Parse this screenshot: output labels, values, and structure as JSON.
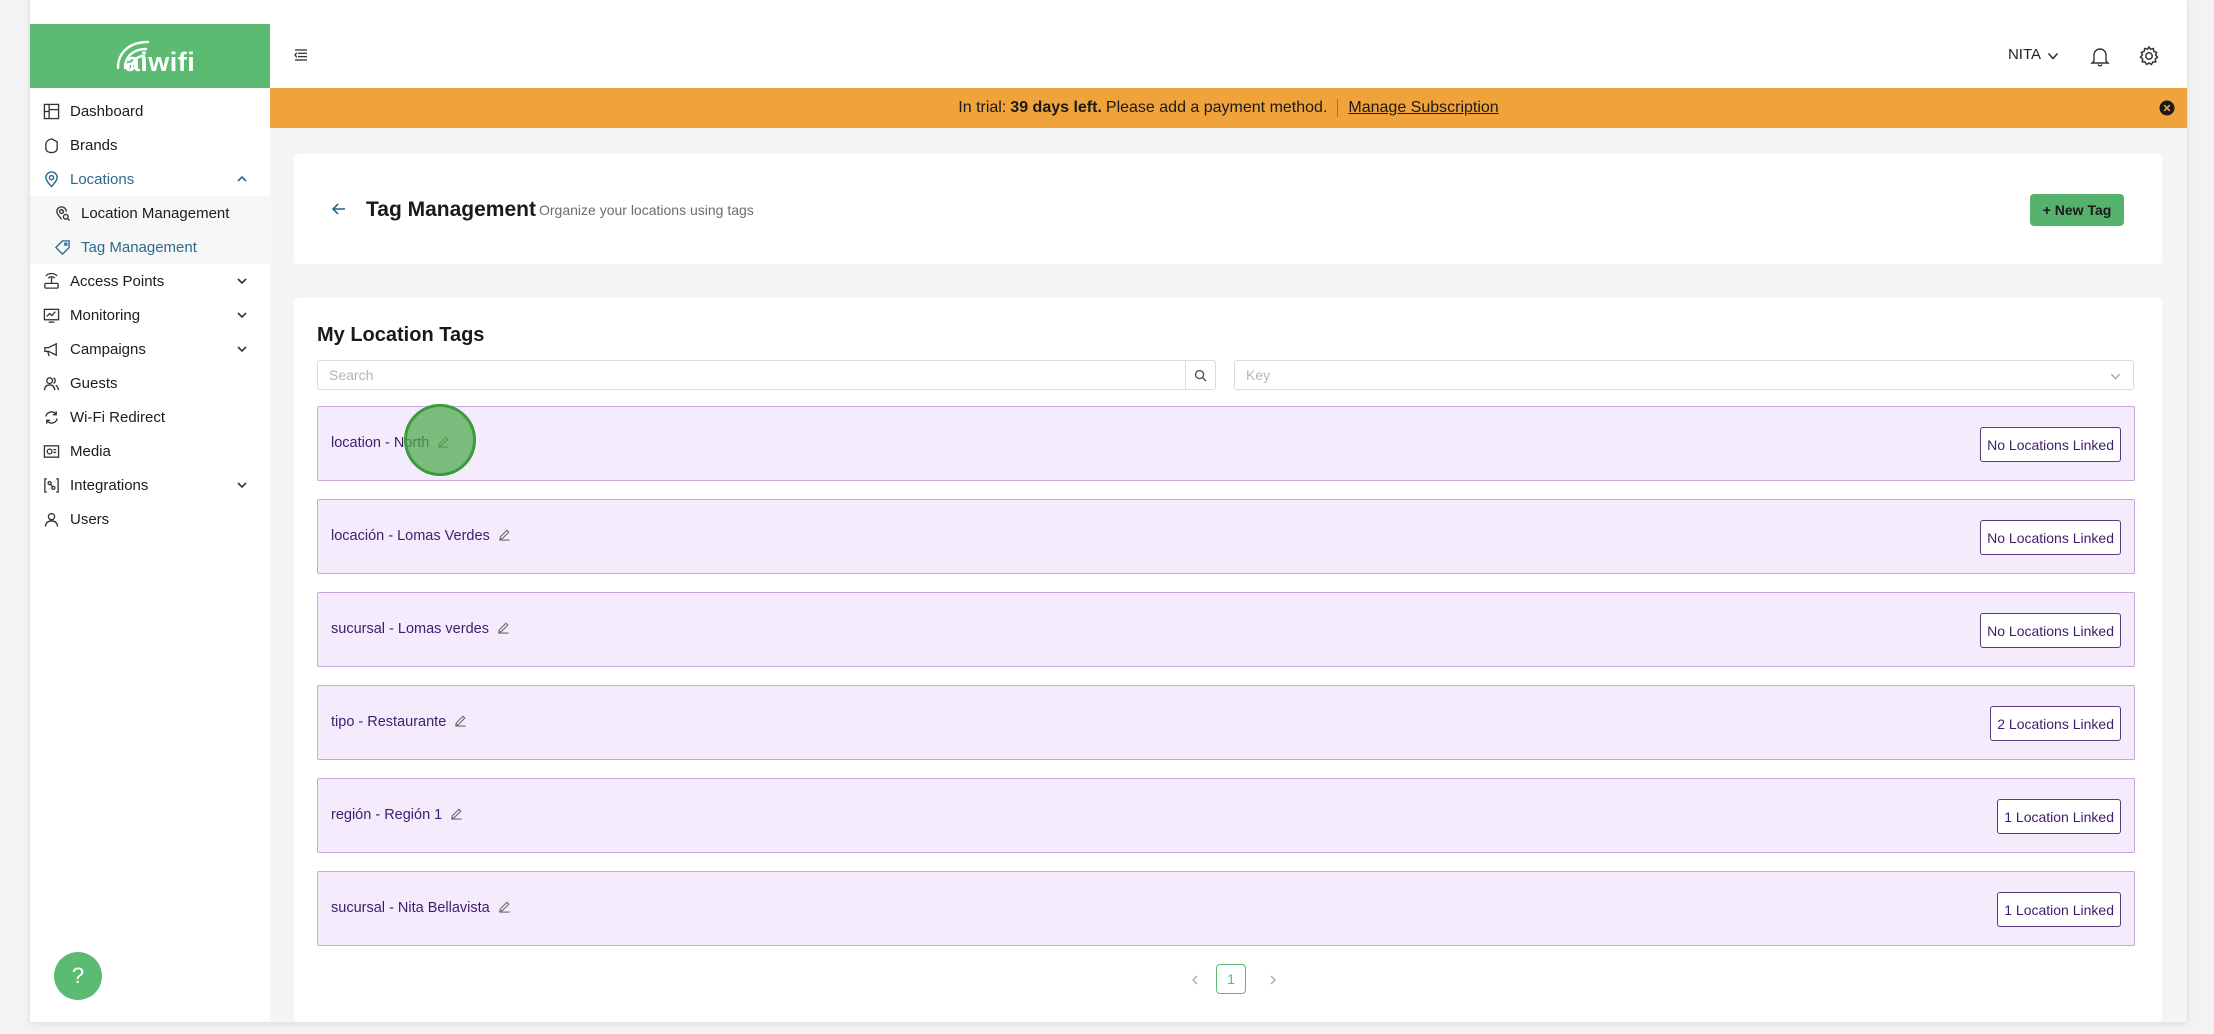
{
  "brand": {
    "name": "aiwifi",
    "color": "#5cbb73"
  },
  "sidebar": {
    "items": [
      {
        "label": "Dashboard",
        "icon": "dashboard-icon"
      },
      {
        "label": "Brands",
        "icon": "brands-icon"
      },
      {
        "label": "Locations",
        "icon": "location-pin-icon",
        "expanded": true
      },
      {
        "label": "Location Management",
        "icon": "location-search-icon"
      },
      {
        "label": "Tag Management",
        "icon": "tag-icon"
      },
      {
        "label": "Access Points",
        "icon": "access-point-icon"
      },
      {
        "label": "Monitoring",
        "icon": "monitor-icon"
      },
      {
        "label": "Campaigns",
        "icon": "megaphone-icon"
      },
      {
        "label": "Guests",
        "icon": "guests-icon"
      },
      {
        "label": "Wi-Fi Redirect",
        "icon": "redirect-icon"
      },
      {
        "label": "Media",
        "icon": "media-icon"
      },
      {
        "label": "Integrations",
        "icon": "integrations-icon"
      },
      {
        "label": "Users",
        "icon": "user-icon"
      }
    ]
  },
  "header": {
    "user": "NITA"
  },
  "banner": {
    "prefix": "In trial:",
    "days": "39 days left.",
    "message": "Please add a payment method.",
    "link": "Manage Subscription",
    "color": "#f0a33b"
  },
  "page": {
    "title": "Tag Management",
    "subtitle": "Organize your locations using tags",
    "new_tag_label": "+ New Tag"
  },
  "list": {
    "title": "My Location Tags",
    "search_placeholder": "Search",
    "key_placeholder": "Key",
    "tags": [
      {
        "label": "location - North",
        "badge": "No Locations Linked"
      },
      {
        "label": "locación - Lomas Verdes",
        "badge": "No Locations Linked"
      },
      {
        "label": "sucursal - Lomas verdes",
        "badge": "No Locations Linked"
      },
      {
        "label": "tipo - Restaurante",
        "badge": "2 Locations Linked"
      },
      {
        "label": "región - Región 1",
        "badge": "1 Location Linked"
      },
      {
        "label": "sucursal - Nita Bellavista",
        "badge": "1 Location Linked"
      }
    ]
  },
  "pagination": {
    "current": "1"
  },
  "help": {
    "label": "?"
  }
}
